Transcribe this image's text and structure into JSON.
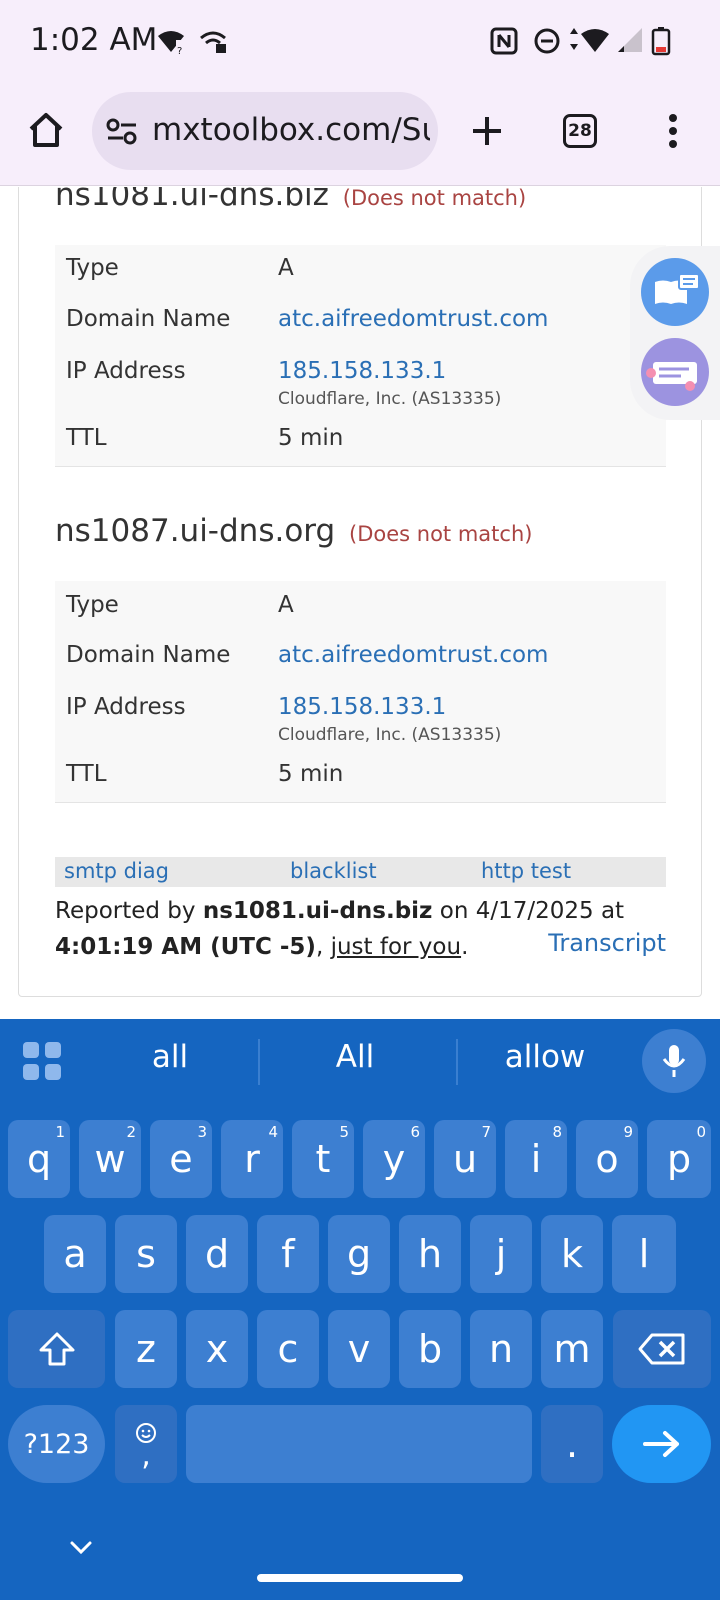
{
  "status_bar": {
    "time": "1:02 AM"
  },
  "browser": {
    "url": "mxtoolbox.com/Su",
    "tab_count": "28"
  },
  "records": [
    {
      "nameserver": "ns1081.ui-dns.biz",
      "status": "(Does not match)",
      "rows": [
        {
          "label": "Type",
          "value": "A"
        },
        {
          "label": "Domain Name",
          "value": "atc.aifreedomtrust.com"
        },
        {
          "label": "IP Address",
          "value": "185.158.133.1",
          "sub": "Cloudflare, Inc. (AS13335)"
        },
        {
          "label": "TTL",
          "value": "5 min"
        }
      ]
    },
    {
      "nameserver": "ns1087.ui-dns.org",
      "status": "(Does not match)",
      "rows": [
        {
          "label": "Type",
          "value": "A"
        },
        {
          "label": "Domain Name",
          "value": "atc.aifreedomtrust.com"
        },
        {
          "label": "IP Address",
          "value": "185.158.133.1",
          "sub": "Cloudflare, Inc. (AS13335)"
        },
        {
          "label": "TTL",
          "value": "5 min"
        }
      ]
    }
  ],
  "links": {
    "smtp": "smtp diag",
    "blacklist": "blacklist",
    "http": "http test"
  },
  "report": {
    "prefix": "Reported by ",
    "server": "ns1081.ui-dns.biz",
    "mid": " on 4/17/2025 at ",
    "time": "4:01:19 AM (UTC -5)",
    "comma": ", ",
    "just": "just for you",
    "end": ".",
    "transcript": "Transcript"
  },
  "keyboard": {
    "suggestions": [
      "all",
      "All",
      "allow"
    ],
    "row1": [
      {
        "k": "q",
        "h": "1"
      },
      {
        "k": "w",
        "h": "2"
      },
      {
        "k": "e",
        "h": "3"
      },
      {
        "k": "r",
        "h": "4"
      },
      {
        "k": "t",
        "h": "5"
      },
      {
        "k": "y",
        "h": "6"
      },
      {
        "k": "u",
        "h": "7"
      },
      {
        "k": "i",
        "h": "8"
      },
      {
        "k": "o",
        "h": "9"
      },
      {
        "k": "p",
        "h": "0"
      }
    ],
    "row2": [
      "a",
      "s",
      "d",
      "f",
      "g",
      "h",
      "j",
      "k",
      "l"
    ],
    "row3": [
      "z",
      "x",
      "c",
      "v",
      "b",
      "n",
      "m"
    ],
    "sym_label": "?123",
    "comma_label": ",",
    "period_label": "."
  },
  "colors": {
    "keyboard_bg": "#1565c0",
    "key": "#3d7fd1",
    "enter": "#2196f3",
    "link": "#2a6fb5",
    "mismatch": "#a94442"
  }
}
